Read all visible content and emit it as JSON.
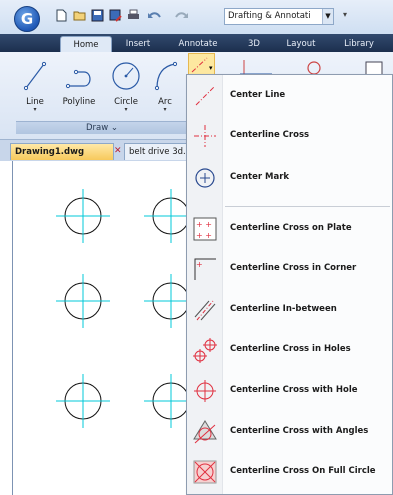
{
  "qat": {
    "app_icon": "gcad-logo-icon",
    "icons": [
      "new-file-icon",
      "open-folder-icon",
      "save-icon",
      "save-as-icon",
      "print-icon",
      "undo-icon",
      "redo-icon"
    ],
    "workspace_value": "Drafting & Annotati"
  },
  "ribbon": {
    "tabs": [
      "Home",
      "Insert",
      "Annotate",
      "3D",
      "Layout",
      "Library"
    ],
    "active_tab": "Home",
    "tools": {
      "line": "Line",
      "polyline": "Polyline",
      "circle": "Circle",
      "arc": "Arc"
    },
    "group_label": "Draw ⌄"
  },
  "documents": {
    "active": "Drawing1.dwg",
    "other": "belt drive 3d."
  },
  "menu": {
    "items": [
      {
        "label": "Center Line",
        "icon": "center-line-icon"
      },
      {
        "label": "Centerline Cross",
        "icon": "centerline-cross-icon"
      },
      {
        "label": "Center Mark",
        "icon": "center-mark-icon"
      },
      {
        "label": "Centerline Cross on Plate",
        "icon": "centerline-cross-plate-icon"
      },
      {
        "label": "Centerline Cross in Corner",
        "icon": "centerline-cross-corner-icon"
      },
      {
        "label": "Centerline In-between",
        "icon": "centerline-in-between-icon"
      },
      {
        "label": "Centerline Cross in Holes",
        "icon": "centerline-cross-holes-icon"
      },
      {
        "label": "Centerline Cross with Hole",
        "icon": "centerline-cross-with-hole-icon"
      },
      {
        "label": "Centerline Cross with Angles",
        "icon": "centerline-cross-angles-icon"
      },
      {
        "label": "Centerline Cross On Full Circle",
        "icon": "centerline-cross-full-circle-icon"
      }
    ]
  },
  "colors": {
    "centerline": "#e03040",
    "canvas_marks": "#00c8d8",
    "highlight": "#fde8a0"
  }
}
